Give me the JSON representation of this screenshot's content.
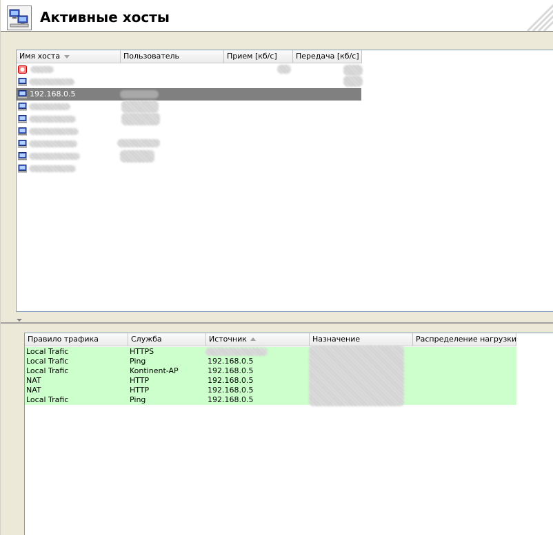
{
  "header": {
    "title": "Активные хосты",
    "icon": "network-computers-icon"
  },
  "hosts_table": {
    "columns": [
      {
        "label": "Имя хоста",
        "sort": "desc"
      },
      {
        "label": "Пользователь",
        "sort": ""
      },
      {
        "label": "Прием [кб/с]",
        "sort": ""
      },
      {
        "label": "Передача [кб/с]",
        "sort": ""
      }
    ],
    "rows": [
      {
        "icon": "warning-host-icon",
        "name": "",
        "selected": false
      },
      {
        "icon": "computer-icon",
        "name": "",
        "selected": false
      },
      {
        "icon": "computer-icon",
        "name": "192.168.0.5",
        "selected": true
      },
      {
        "icon": "computer-icon",
        "name": "",
        "selected": false
      },
      {
        "icon": "computer-icon",
        "name": "",
        "selected": false
      },
      {
        "icon": "computer-icon",
        "name": "",
        "selected": false
      },
      {
        "icon": "computer-icon",
        "name": "",
        "selected": false
      },
      {
        "icon": "computer-icon",
        "name": "",
        "selected": false
      },
      {
        "icon": "computer-icon",
        "name": "",
        "selected": false
      }
    ]
  },
  "traffic_table": {
    "columns": [
      {
        "label": "Правило трафика",
        "sort": ""
      },
      {
        "label": "Служба",
        "sort": ""
      },
      {
        "label": "Источник",
        "sort": "asc"
      },
      {
        "label": "Назначение",
        "sort": ""
      },
      {
        "label": "Распределение нагрузки",
        "sort": ""
      }
    ],
    "rows": [
      {
        "rule": "Local Trafic",
        "service": "HTTPS",
        "source": "",
        "destination": "",
        "balance": ""
      },
      {
        "rule": "Local Trafic",
        "service": "Ping",
        "source": "192.168.0.5",
        "destination": "",
        "balance": ""
      },
      {
        "rule": "Local Trafic",
        "service": "Kontinent-AP",
        "source": "192.168.0.5",
        "destination": "",
        "balance": ""
      },
      {
        "rule": "NAT",
        "service": "HTTP",
        "source": "192.168.0.5",
        "destination": "",
        "balance": ""
      },
      {
        "rule": "NAT",
        "service": "HTTP",
        "source": "192.168.0.5",
        "destination": "",
        "balance": ""
      },
      {
        "rule": "Local Trafic",
        "service": "Ping",
        "source": "192.168.0.5",
        "destination": "",
        "balance": ""
      }
    ],
    "row_color": "#ccffcc"
  },
  "colors": {
    "selection": "#808080",
    "grid_border": "#7f9db9",
    "pane_background": "#ece9d8"
  }
}
